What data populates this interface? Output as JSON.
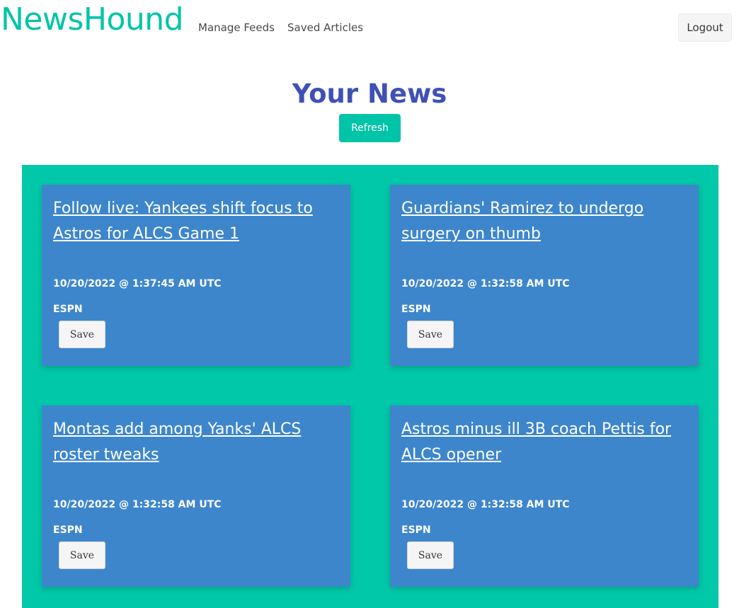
{
  "navbar": {
    "brand": "NewsHound",
    "links": [
      {
        "label": "Manage Feeds"
      },
      {
        "label": "Saved Articles"
      }
    ],
    "logout_label": "Logout"
  },
  "main": {
    "title": "Your News",
    "refresh_label": "Refresh"
  },
  "articles": [
    {
      "title": "Follow live: Yankees shift focus to Astros for ALCS Game 1",
      "date": "10/20/2022 @ 1:37:45 AM UTC",
      "source": "ESPN",
      "save_label": "Save"
    },
    {
      "title": "Guardians' Ramirez to undergo surgery on thumb",
      "date": "10/20/2022 @ 1:32:58 AM UTC",
      "source": "ESPN",
      "save_label": "Save"
    },
    {
      "title": "Montas add among Yanks' ALCS roster tweaks",
      "date": "10/20/2022 @ 1:32:58 AM UTC",
      "source": "ESPN",
      "save_label": "Save"
    },
    {
      "title": "Astros minus ill 3B coach Pettis for ALCS opener",
      "date": "10/20/2022 @ 1:32:58 AM UTC",
      "source": "ESPN",
      "save_label": "Save"
    }
  ],
  "colors": {
    "brand": "#00c4a7",
    "title": "#3f51b5",
    "panel": "#00c8a8",
    "card": "#3d86cc"
  }
}
